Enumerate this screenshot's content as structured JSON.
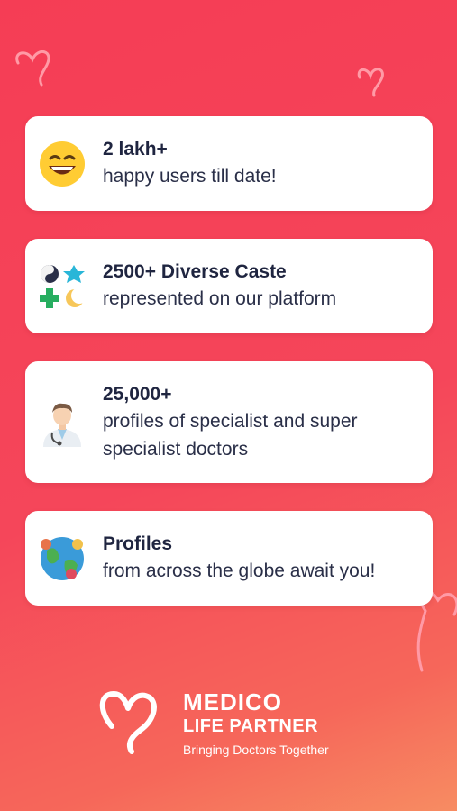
{
  "stats": [
    {
      "title": "2 lakh+",
      "description": "happy users till date!",
      "icon": "grinning-face-icon"
    },
    {
      "title": "2500+ Diverse Caste",
      "description": "represented on our platform",
      "icon": "religion-symbols-icon"
    },
    {
      "title": "25,000+",
      "description": "profiles of specialist and super specialist doctors",
      "icon": "doctor-icon"
    },
    {
      "title": "Profiles",
      "description": "from across the globe await you!",
      "icon": "globe-people-icon"
    }
  ],
  "brand": {
    "name": "MEDICO",
    "subtitle": "LIFE PARTNER",
    "tagline": "Bringing Doctors Together"
  }
}
